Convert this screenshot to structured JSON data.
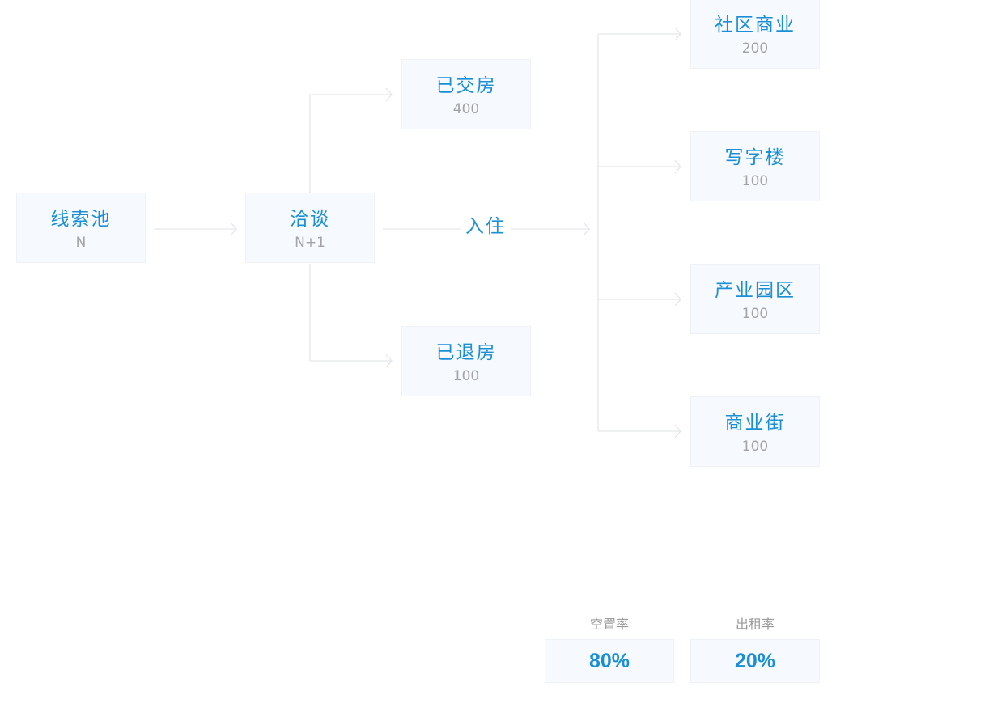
{
  "nodes": {
    "clue_pool": {
      "title": "线索池",
      "value": "N"
    },
    "negotiation": {
      "title": "洽谈",
      "value": "N+1"
    },
    "delivered": {
      "title": "已交房",
      "value": "400"
    },
    "returned": {
      "title": "已退房",
      "value": "100"
    },
    "community_commerce": {
      "title": "社区商业",
      "value": "200"
    },
    "office_building": {
      "title": "写字楼",
      "value": "100"
    },
    "industrial_park": {
      "title": "产业园区",
      "value": "100"
    },
    "commercial_street": {
      "title": "商业街",
      "value": "100"
    }
  },
  "edge_label": "入住",
  "metrics": {
    "vacancy": {
      "label": "空置率",
      "value": "80%"
    },
    "rental": {
      "label": "出租率",
      "value": "20%"
    }
  },
  "colors": {
    "accent": "#1a8fd6",
    "muted_text": "#a3a3a3",
    "box_fill": "#f6f9fd",
    "connector": "#e3e6ea"
  }
}
